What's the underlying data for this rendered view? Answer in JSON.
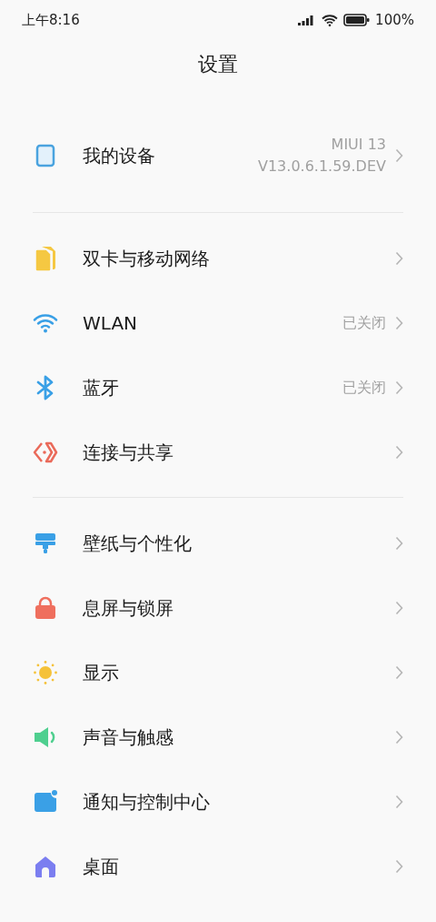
{
  "status_bar": {
    "time": "上午8:16",
    "battery": "100%"
  },
  "title": "设置",
  "groups": [
    [
      {
        "kind": "device",
        "label": "我的设备",
        "values": [
          "MIUI 13",
          "V13.0.6.1.59.DEV"
        ]
      }
    ],
    [
      {
        "kind": "sim",
        "label": "双卡与移动网络"
      },
      {
        "kind": "wifi",
        "label": "WLAN",
        "values": [
          "已关闭"
        ]
      },
      {
        "kind": "bluetooth",
        "label": "蓝牙",
        "values": [
          "已关闭"
        ]
      },
      {
        "kind": "share",
        "label": "连接与共享"
      }
    ],
    [
      {
        "kind": "wallpaper",
        "label": "壁纸与个性化"
      },
      {
        "kind": "lock",
        "label": "息屏与锁屏"
      },
      {
        "kind": "display",
        "label": "显示"
      },
      {
        "kind": "sound",
        "label": "声音与触感"
      },
      {
        "kind": "notification",
        "label": "通知与控制中心"
      },
      {
        "kind": "home",
        "label": "桌面"
      }
    ]
  ]
}
